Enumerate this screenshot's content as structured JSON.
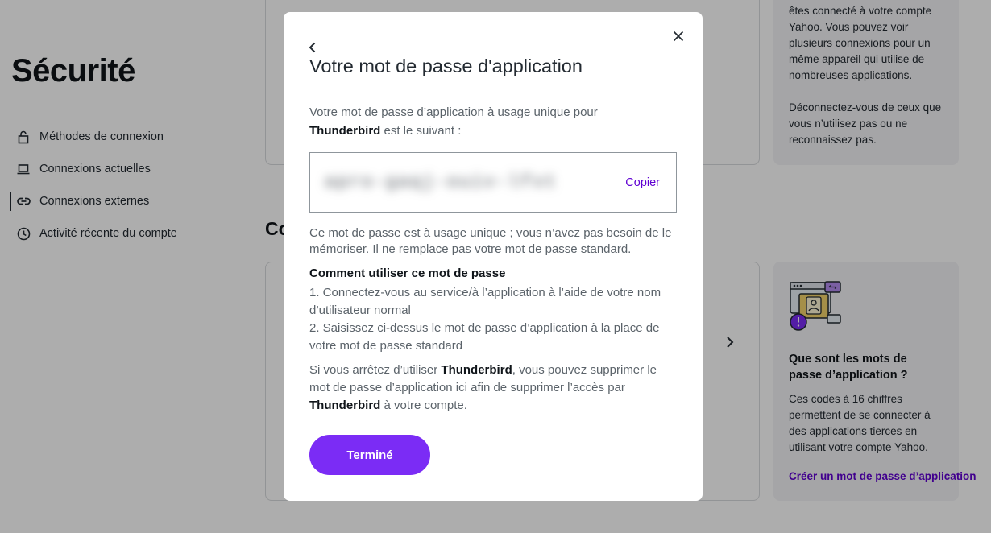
{
  "page": {
    "title": "Sécurité",
    "section_heading_partial": "Co"
  },
  "nav": {
    "items": [
      {
        "label": "Méthodes de connexion",
        "icon": "lock-icon"
      },
      {
        "label": "Connexions actuelles",
        "icon": "laptop-icon"
      },
      {
        "label": "Connexions externes",
        "icon": "link-icon",
        "active": true
      },
      {
        "label": "Activité récente du compte",
        "icon": "clock-icon"
      }
    ]
  },
  "side_top": {
    "paragraph1": "êtes connecté à votre compte Yahoo. Vous pouvez voir plusieurs connexions pour un même appareil qui utilise de nombreuses applications.",
    "paragraph2": "Déconnectez-vous de ceux que vous n’utilisez pas ou ne reconnaissez pas."
  },
  "side_bottom": {
    "title": "Que sont les mots de passe d’application ?",
    "text": "Ces codes à 16 chiffres permettent de se connecter à des applications tierces en utilisant votre compte Yahoo.",
    "link": "Créer un mot de passe d’application"
  },
  "modal": {
    "title": "Votre mot de passe d'application",
    "intro_prefix": "Votre mot de passe d’application à usage unique pour",
    "app_name": "Thunderbird",
    "intro_suffix": "est le suivant :",
    "password": "apro-gaqj-ouiv-lfxt",
    "copy_label": "Copier",
    "one_time_note": "Ce mot de passe est à usage unique ; vous n’avez pas besoin de le mémoriser. Il ne remplace pas votre mot de passe standard.",
    "howto_title": "Comment utiliser ce mot de passe",
    "step1": "1. Connectez-vous au service/à l’application à l’aide de votre nom d’utilisateur normal",
    "step2": "2. Saisissez ci-dessus le mot de passe d’application à la place de votre mot de passe standard",
    "usage_prefix": "Si vous arrêtez d’utiliser",
    "usage_middle": ", vous pouvez supprimer le mot de passe d’application ici afin de supprimer l’accès par",
    "usage_suffix": "à votre compte.",
    "done_label": "Terminé"
  },
  "colors": {
    "accent": "#7b2cf5",
    "link": "#6001d2",
    "overlay": "rgba(0,0,0,0.32)"
  }
}
